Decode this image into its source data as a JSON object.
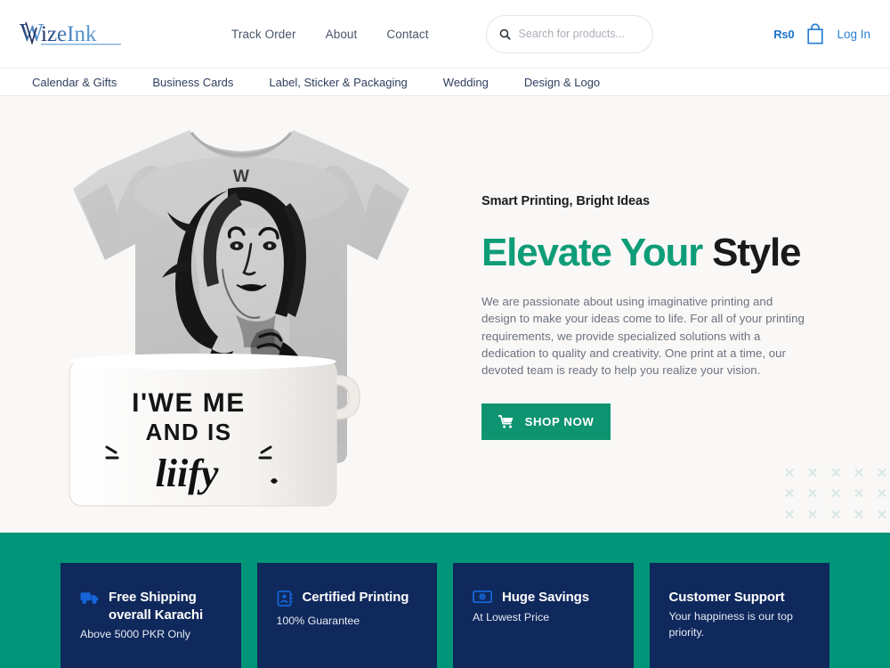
{
  "brand": {
    "name": "WizeInk",
    "logo_colors": [
      "#1b2a5c",
      "#3f7fc1",
      "#6fa8dc"
    ]
  },
  "header": {
    "nav": [
      {
        "label": "Track Order",
        "name": "track-order"
      },
      {
        "label": "About",
        "name": "about"
      },
      {
        "label": "Contact",
        "name": "contact"
      }
    ],
    "search": {
      "placeholder": "Search for products...",
      "value": ""
    },
    "cart": {
      "price_label": "Rs0",
      "icon": "shopping-bag-icon"
    },
    "login_label": "Log In"
  },
  "categories": [
    {
      "label": "Calendar & Gifts"
    },
    {
      "label": "Business Cards"
    },
    {
      "label": "Label, Sticker & Packaging"
    },
    {
      "label": "Wedding"
    },
    {
      "label": "Design & Logo"
    }
  ],
  "hero": {
    "eyebrow": "Smart Printing, Bright Ideas",
    "headline_part1": "Elevate Your",
    "headline_part2": "Style",
    "paragraph": "We are passionate about using imaginative printing and design to make your ideas come to life. For all of your printing requirements, we provide specialized solutions with a dedication to quality and creativity. One print at a time, our devoted team is ready to help you realize your vision.",
    "cta_label": "SHOP NOW",
    "cta_icon": "shopping-cart-icon",
    "accent_color": "#0f9d78",
    "background_color": "#faf8f6",
    "product_image": {
      "alt": "Grey t-shirt with black-and-white portrait print and white mug",
      "shirt_tag_letter": "W",
      "mug_line1": "I'WE ME",
      "mug_line2": "AND IS",
      "mug_script": "liify"
    },
    "decoration": {
      "symbol": "✕",
      "rows": 3,
      "cols": 5,
      "color": "#d6e8e4"
    }
  },
  "features": {
    "background_color": "#009578",
    "card_color": "#10295c",
    "cards": [
      {
        "icon": "truck-icon",
        "title": "Free Shipping overall Karachi",
        "subtitle": "Above 5000 PKR Only"
      },
      {
        "icon": "certificate-id-icon",
        "title": "Certified Printing",
        "subtitle": "100% Guarantee"
      },
      {
        "icon": "money-bill-icon",
        "title": "Huge Savings",
        "subtitle": "At Lowest Price"
      },
      {
        "icon": "none",
        "title": "Customer Support",
        "subtitle": "Your happiness is our top priority."
      }
    ]
  }
}
